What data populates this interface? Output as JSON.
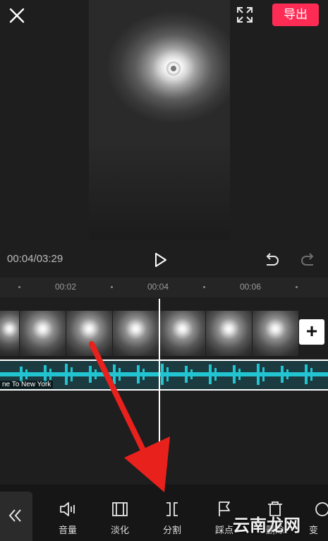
{
  "header": {
    "close_icon": "close-icon",
    "fullscreen_icon": "fullscreen-icon",
    "export_label": "导出"
  },
  "playback": {
    "timecode": "00:04/03:29",
    "play_icon": "play-icon",
    "undo_icon": "undo-icon",
    "redo_icon": "redo-icon"
  },
  "timeline": {
    "ruler_labels": [
      "00:02",
      "00:04",
      "00:06"
    ],
    "audio_title": "ne To New York",
    "add_clip_label": "+"
  },
  "toolbar": {
    "collapse_icon": "double-chevron-left-icon",
    "tools": [
      {
        "label": "音量",
        "icon": "volume-icon"
      },
      {
        "label": "淡化",
        "icon": "fade-icon"
      },
      {
        "label": "分割",
        "icon": "split-icon"
      },
      {
        "label": "踩点",
        "icon": "flag-icon"
      },
      {
        "label": "删除",
        "icon": "delete-icon"
      },
      {
        "label": "变",
        "icon": "speed-icon"
      }
    ]
  },
  "watermark": {
    "text": "云南龙网"
  },
  "colors": {
    "accent": "#fe2c55",
    "waveform": "#21c4d0",
    "annotation_arrow": "#e8211d",
    "background": "#1e1e1e"
  }
}
